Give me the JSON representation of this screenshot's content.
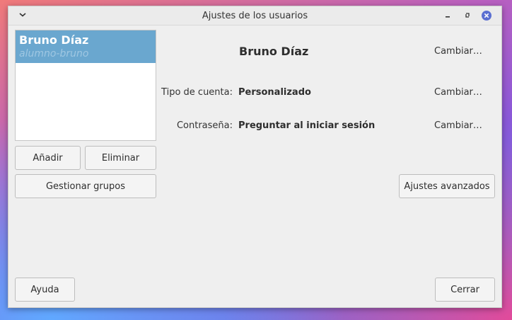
{
  "window": {
    "title": "Ajustes de los usuarios"
  },
  "users": [
    {
      "name": "Bruno Díaz",
      "login": "alumno-bruno",
      "selected": true
    }
  ],
  "buttons": {
    "add": "Añadir",
    "remove": "Eliminar",
    "manage_groups": "Gestionar grupos",
    "advanced": "Ajustes avanzados",
    "help": "Ayuda",
    "close": "Cerrar"
  },
  "details": {
    "full_name": "Bruno Díaz",
    "account_type_label": "Tipo de cuenta:",
    "account_type_value": "Personalizado",
    "password_label": "Contraseña:",
    "password_value": "Preguntar al iniciar sesión",
    "change_label": "Cambiar…"
  },
  "icons": {
    "menu": "chevron-down-icon",
    "minimize": "minimize-icon",
    "maximize": "maximize-icon",
    "close": "close-icon"
  },
  "colors": {
    "selection": "#6aa7cf",
    "close_button": "#5b6fd1"
  }
}
